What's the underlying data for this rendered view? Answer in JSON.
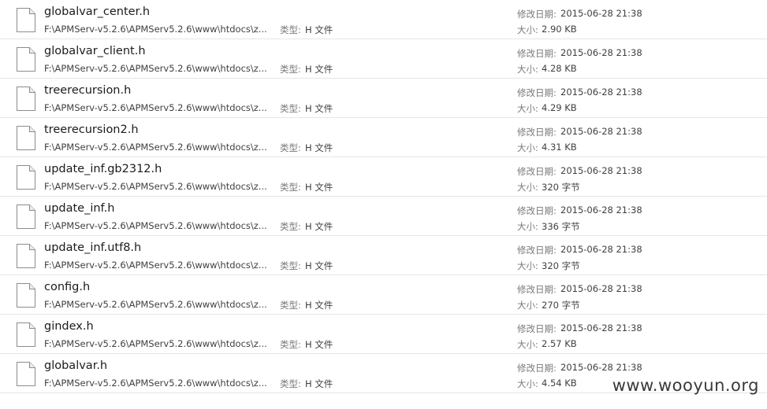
{
  "labels": {
    "type": "类型:",
    "modified": "修改日期:",
    "size": "大小:"
  },
  "files": [
    {
      "name": "globalvar_center.h",
      "path": "F:\\APMServ-v5.2.6\\APMServ5.2.6\\www\\htdocs\\z...",
      "type": "H 文件",
      "modified": "2015-06-28 21:38",
      "size": "2.90 KB",
      "icon": "document-icon"
    },
    {
      "name": "globalvar_client.h",
      "path": "F:\\APMServ-v5.2.6\\APMServ5.2.6\\www\\htdocs\\z...",
      "type": "H 文件",
      "modified": "2015-06-28 21:38",
      "size": "4.28 KB",
      "icon": "document-icon"
    },
    {
      "name": "treerecursion.h",
      "path": "F:\\APMServ-v5.2.6\\APMServ5.2.6\\www\\htdocs\\z...",
      "type": "H 文件",
      "modified": "2015-06-28 21:38",
      "size": "4.29 KB",
      "icon": "document-icon"
    },
    {
      "name": "treerecursion2.h",
      "path": "F:\\APMServ-v5.2.6\\APMServ5.2.6\\www\\htdocs\\z...",
      "type": "H 文件",
      "modified": "2015-06-28 21:38",
      "size": "4.31 KB",
      "icon": "document-icon"
    },
    {
      "name": "update_inf.gb2312.h",
      "path": "F:\\APMServ-v5.2.6\\APMServ5.2.6\\www\\htdocs\\z...",
      "type": "H 文件",
      "modified": "2015-06-28 21:38",
      "size": "320 字节",
      "icon": "document-icon"
    },
    {
      "name": "update_inf.h",
      "path": "F:\\APMServ-v5.2.6\\APMServ5.2.6\\www\\htdocs\\z...",
      "type": "H 文件",
      "modified": "2015-06-28 21:38",
      "size": "336 字节",
      "icon": "document-icon"
    },
    {
      "name": "update_inf.utf8.h",
      "path": "F:\\APMServ-v5.2.6\\APMServ5.2.6\\www\\htdocs\\z...",
      "type": "H 文件",
      "modified": "2015-06-28 21:38",
      "size": "320 字节",
      "icon": "document-icon"
    },
    {
      "name": "config.h",
      "path": "F:\\APMServ-v5.2.6\\APMServ5.2.6\\www\\htdocs\\z...",
      "type": "H 文件",
      "modified": "2015-06-28 21:38",
      "size": "270 字节",
      "icon": "document-icon"
    },
    {
      "name": "gindex.h",
      "path": "F:\\APMServ-v5.2.6\\APMServ5.2.6\\www\\htdocs\\z...",
      "type": "H 文件",
      "modified": "2015-06-28 21:38",
      "size": "2.57 KB",
      "icon": "document-icon"
    },
    {
      "name": "globalvar.h",
      "path": "F:\\APMServ-v5.2.6\\APMServ5.2.6\\www\\htdocs\\z...",
      "type": "H 文件",
      "modified": "2015-06-28 21:38",
      "size": "4.54 KB",
      "icon": "document-icon"
    }
  ],
  "watermark": "www.wooyun.org"
}
